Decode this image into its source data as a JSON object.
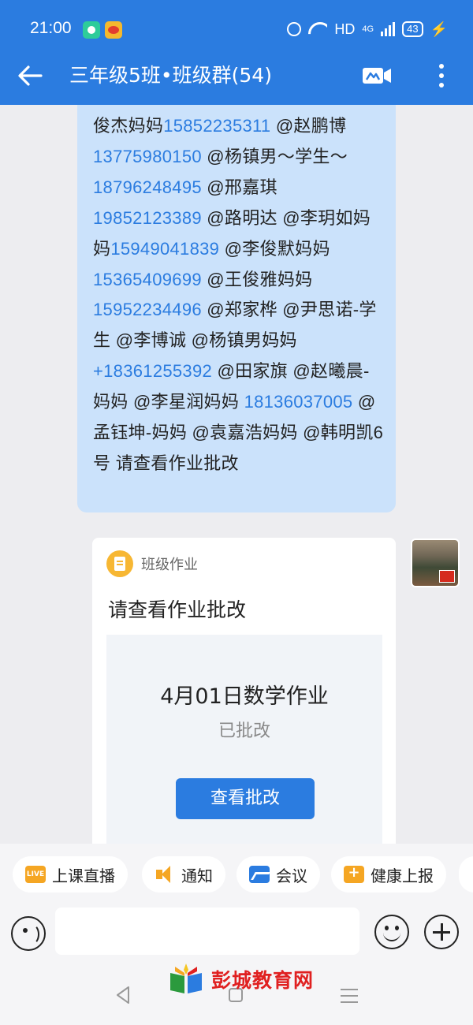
{
  "status_bar": {
    "time": "21:00",
    "hd": "HD",
    "network": "4G",
    "battery": "43"
  },
  "app_bar": {
    "title": "三年级5班•班级群(54)",
    "icons": [
      "back-arrow-icon",
      "video-call-icon",
      "more-vertical-icon"
    ]
  },
  "message": {
    "segments": [
      {
        "text": "俊杰妈妈",
        "type": "text"
      },
      {
        "text": "15852235311",
        "type": "phone"
      },
      {
        "text": " @赵鹏博",
        "type": "text"
      },
      {
        "text": "13775980150",
        "type": "phone"
      },
      {
        "text": " @杨镇男～学生～",
        "type": "text"
      },
      {
        "text": "18796248495",
        "type": "phone"
      },
      {
        "text": " @邢嘉琪 ",
        "type": "text"
      },
      {
        "text": "19852123389",
        "type": "phone"
      },
      {
        "text": " @路明达 @李玥如妈妈",
        "type": "text"
      },
      {
        "text": "15949041839",
        "type": "phone"
      },
      {
        "text": " @李俊默妈妈",
        "type": "text"
      },
      {
        "text": "15365409699",
        "type": "phone"
      },
      {
        "text": " @王俊雅妈妈",
        "type": "text"
      },
      {
        "text": "15952234496",
        "type": "phone"
      },
      {
        "text": " @郑家桦 @尹思诺-学生 @李博诚 @杨镇男妈妈",
        "type": "text"
      },
      {
        "text": "+18361255392",
        "type": "phone"
      },
      {
        "text": " @田家旗 @赵曦晨-妈妈 @李星润妈妈 ",
        "type": "text"
      },
      {
        "text": "18136037005",
        "type": "phone"
      },
      {
        "text": " @孟钰坤-妈妈 @袁嘉浩妈妈 @韩明凯6号 ",
        "type": "text"
      },
      {
        "text": "请查看作业批改",
        "type": "text"
      }
    ]
  },
  "homework_card": {
    "tag": "班级作业",
    "heading": "请查看作业批改",
    "assignment": "4月01日数学作业",
    "status": "已批改",
    "button": "查看批改"
  },
  "quick_actions": [
    {
      "label": "上课直播",
      "icon": "live-icon",
      "badge": "LIVE"
    },
    {
      "label": "通知",
      "icon": "megaphone-icon"
    },
    {
      "label": "会议",
      "icon": "meeting-icon"
    },
    {
      "label": "健康上报",
      "icon": "health-report-icon"
    }
  ],
  "input_bar": {
    "placeholder": "",
    "icons": [
      "voice-icon",
      "emoji-icon",
      "plus-icon"
    ]
  },
  "watermark": {
    "text": "彭城教育网"
  },
  "colors": {
    "primary": "#2b7ce0",
    "bubble": "#cbe2fb",
    "accent": "#f5a623"
  }
}
